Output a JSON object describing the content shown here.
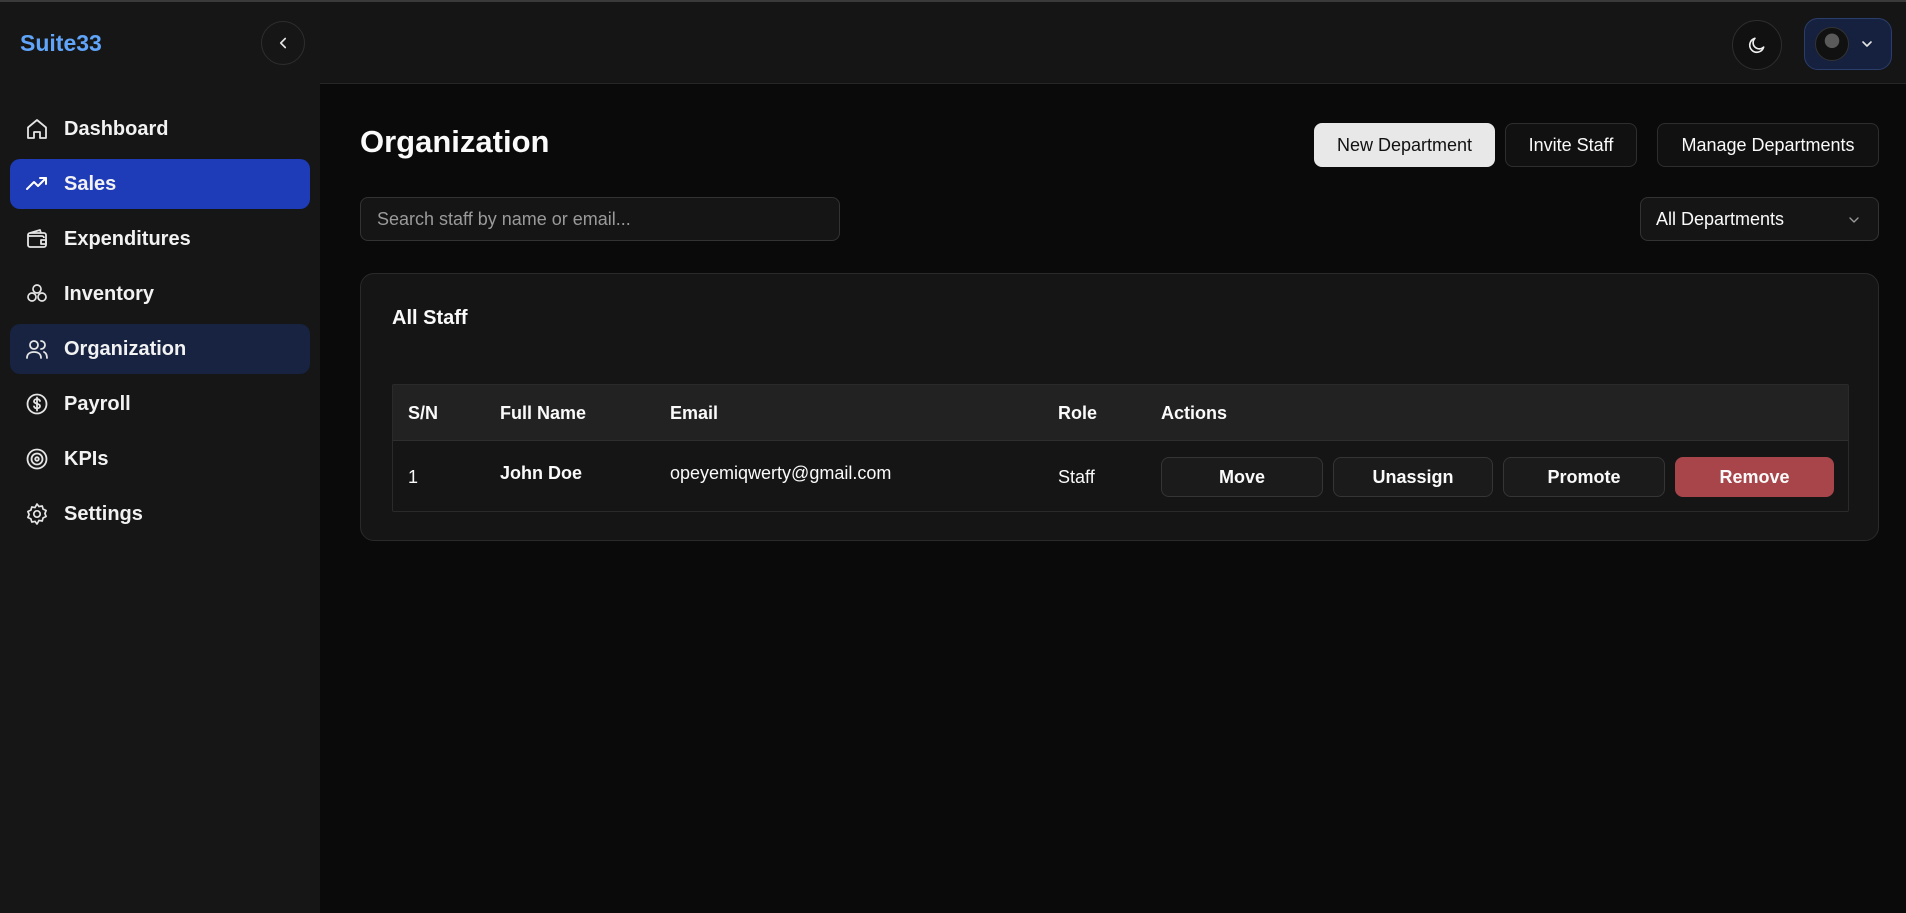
{
  "brand": "Suite33",
  "sidebar": {
    "items": [
      {
        "label": "Dashboard",
        "icon": "home-icon"
      },
      {
        "label": "Sales",
        "icon": "trending-up-icon"
      },
      {
        "label": "Expenditures",
        "icon": "wallet-icon"
      },
      {
        "label": "Inventory",
        "icon": "boxes-icon"
      },
      {
        "label": "Organization",
        "icon": "users-icon"
      },
      {
        "label": "Payroll",
        "icon": "dollar-circle-icon"
      },
      {
        "label": "KPIs",
        "icon": "target-icon"
      },
      {
        "label": "Settings",
        "icon": "gear-icon"
      }
    ]
  },
  "header": {
    "theme_icon": "moon-icon",
    "user_icon": "avatar"
  },
  "main": {
    "title": "Organization",
    "buttons": {
      "new_department": "New Department",
      "invite_staff": "Invite Staff",
      "manage_departments": "Manage Departments"
    },
    "search": {
      "placeholder": "Search staff by name or email...",
      "value": ""
    },
    "department_filter": {
      "selected": "All Departments"
    },
    "card": {
      "title": "All Staff",
      "columns": [
        "S/N",
        "Full Name",
        "Email",
        "Role",
        "Actions"
      ],
      "rows": [
        {
          "sn": "1",
          "full_name": "John Doe",
          "email": "opeyemiqwerty@gmail.com",
          "role": "Staff",
          "actions": [
            "Move",
            "Unassign",
            "Promote",
            "Remove"
          ]
        }
      ]
    }
  },
  "colors": {
    "accent": "#1e3bb8",
    "brand": "#60a5fa",
    "danger": "#a7454a",
    "background": "#0a0a0a"
  }
}
